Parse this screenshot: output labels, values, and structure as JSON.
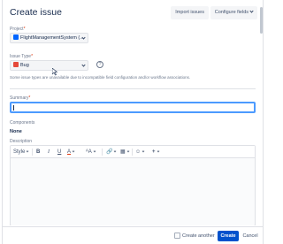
{
  "header": {
    "title": "Create issue",
    "import_label": "Import issues",
    "configure_label": "Configure fields"
  },
  "form": {
    "project": {
      "label": "Project",
      "required_mark": "*",
      "value": "FlightManagementSystem (..."
    },
    "issue_type": {
      "label": "Issue Type",
      "required_mark": "*",
      "value": "Bug",
      "hint": "Some issue types are unavailable due to incompatible field configuration and/or workflow associations."
    },
    "summary": {
      "label": "Summary",
      "required_mark": "*",
      "value": ""
    },
    "components": {
      "label": "Components",
      "value": "None"
    },
    "description": {
      "label": "Description",
      "toolbar": {
        "style": "Style",
        "bold": "B",
        "italic": "I",
        "underline": "U",
        "color": "A",
        "size": "ᴬA",
        "link": "🔗",
        "table": "▦",
        "emoji": "☺",
        "plus": "+"
      }
    }
  },
  "footer": {
    "create_another_label": "Create another",
    "create_label": "Create",
    "cancel_label": "Cancel"
  },
  "colors": {
    "primary": "#0052cc",
    "focus": "#4c9aff",
    "required": "#de350b",
    "bug": "#e5493a"
  }
}
